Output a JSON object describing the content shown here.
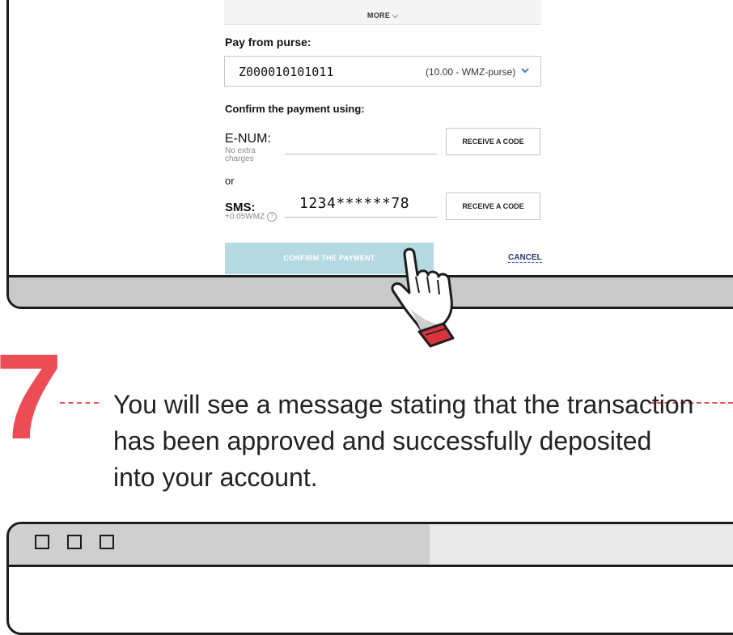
{
  "form": {
    "more_label": "MORE",
    "pay_from_label": "Pay from purse:",
    "purse_id": "Z000010101011",
    "purse_balance": "(10.00 - WMZ-purse)",
    "confirm_using_label": "Confirm the payment using:",
    "enum_label": "E-NUM:",
    "enum_sub": "No extra charges",
    "enum_button": "RECEIVE A CODE",
    "or_label": "or",
    "sms_label": "SMS:",
    "sms_sub": "+0.05WMZ",
    "sms_value": "1234******78",
    "sms_button": "RECEIVE A CODE",
    "confirm_button": "CONFIRM THE PAYMENT",
    "cancel_link": "CANCEL"
  },
  "step": {
    "number": "7",
    "text": "You will see a message stating that the transaction has been approved and successfully deposited into your account."
  },
  "colors": {
    "accent": "#ec4c54",
    "confirm_button_bg": "#b4d9e2",
    "link_blue": "#2a6fd1",
    "window_bar": "#c9c9c9"
  },
  "icons": [
    "chevron-down-icon",
    "help-icon",
    "hand-pointer-icon",
    "window-square-icon"
  ]
}
